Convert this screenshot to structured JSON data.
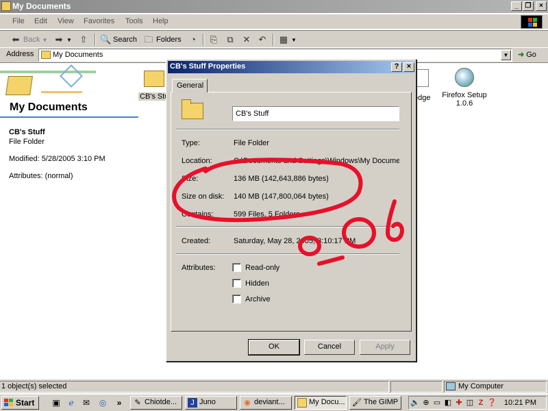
{
  "window": {
    "title": "My Documents"
  },
  "menu": {
    "items": [
      "File",
      "Edit",
      "View",
      "Favorites",
      "Tools",
      "Help"
    ]
  },
  "toolbar": {
    "back": "Back",
    "search": "Search",
    "folders": "Folders"
  },
  "address": {
    "label": "Address",
    "value": "My Documents",
    "go": "Go"
  },
  "left_panel": {
    "title": "My Documents",
    "selected_name": "CB's Stuff",
    "selected_type": "File Folder",
    "modified": "Modified: 5/28/2005 3:10 PM",
    "attributes": "Attributes: (normal)"
  },
  "files": [
    {
      "label": "CB's Stu"
    },
    {
      "label": "edge"
    },
    {
      "label": "Firefox Setup 1.0.6"
    }
  ],
  "dialog": {
    "title": "CB's Stuff Properties",
    "help": "?",
    "close": "×",
    "tab": "General",
    "name": "CB's Stuff",
    "fields": {
      "type_label": "Type:",
      "type_value": "File Folder",
      "location_label": "Location:",
      "location_value": "C:\\Documents and Settings\\Windows\\My Documents",
      "size_label": "Size:",
      "size_value": "136 MB (142,643,886 bytes)",
      "size_on_disk_label": "Size on disk:",
      "size_on_disk_value": "140 MB (147,800,064 bytes)",
      "contains_label": "Contains:",
      "contains_value": "599 Files, 5 Folders",
      "created_label": "Created:",
      "created_value": "Saturday, May 28, 2005, 3:10:17 PM",
      "attributes_label": "Attributes:"
    },
    "checkboxes": [
      "Read-only",
      "Hidden",
      "Archive"
    ],
    "buttons": {
      "ok": "OK",
      "cancel": "Cancel",
      "apply": "Apply"
    }
  },
  "statusbar": {
    "left": "1 object(s) selected",
    "right": "My Computer"
  },
  "taskbar": {
    "start": "Start",
    "tasks": [
      "Chiotde...",
      "Juno",
      "deviant...",
      "My Docu...",
      "The GIMP"
    ],
    "clock": "10:21 PM"
  },
  "annotation_color": "#e8102a"
}
